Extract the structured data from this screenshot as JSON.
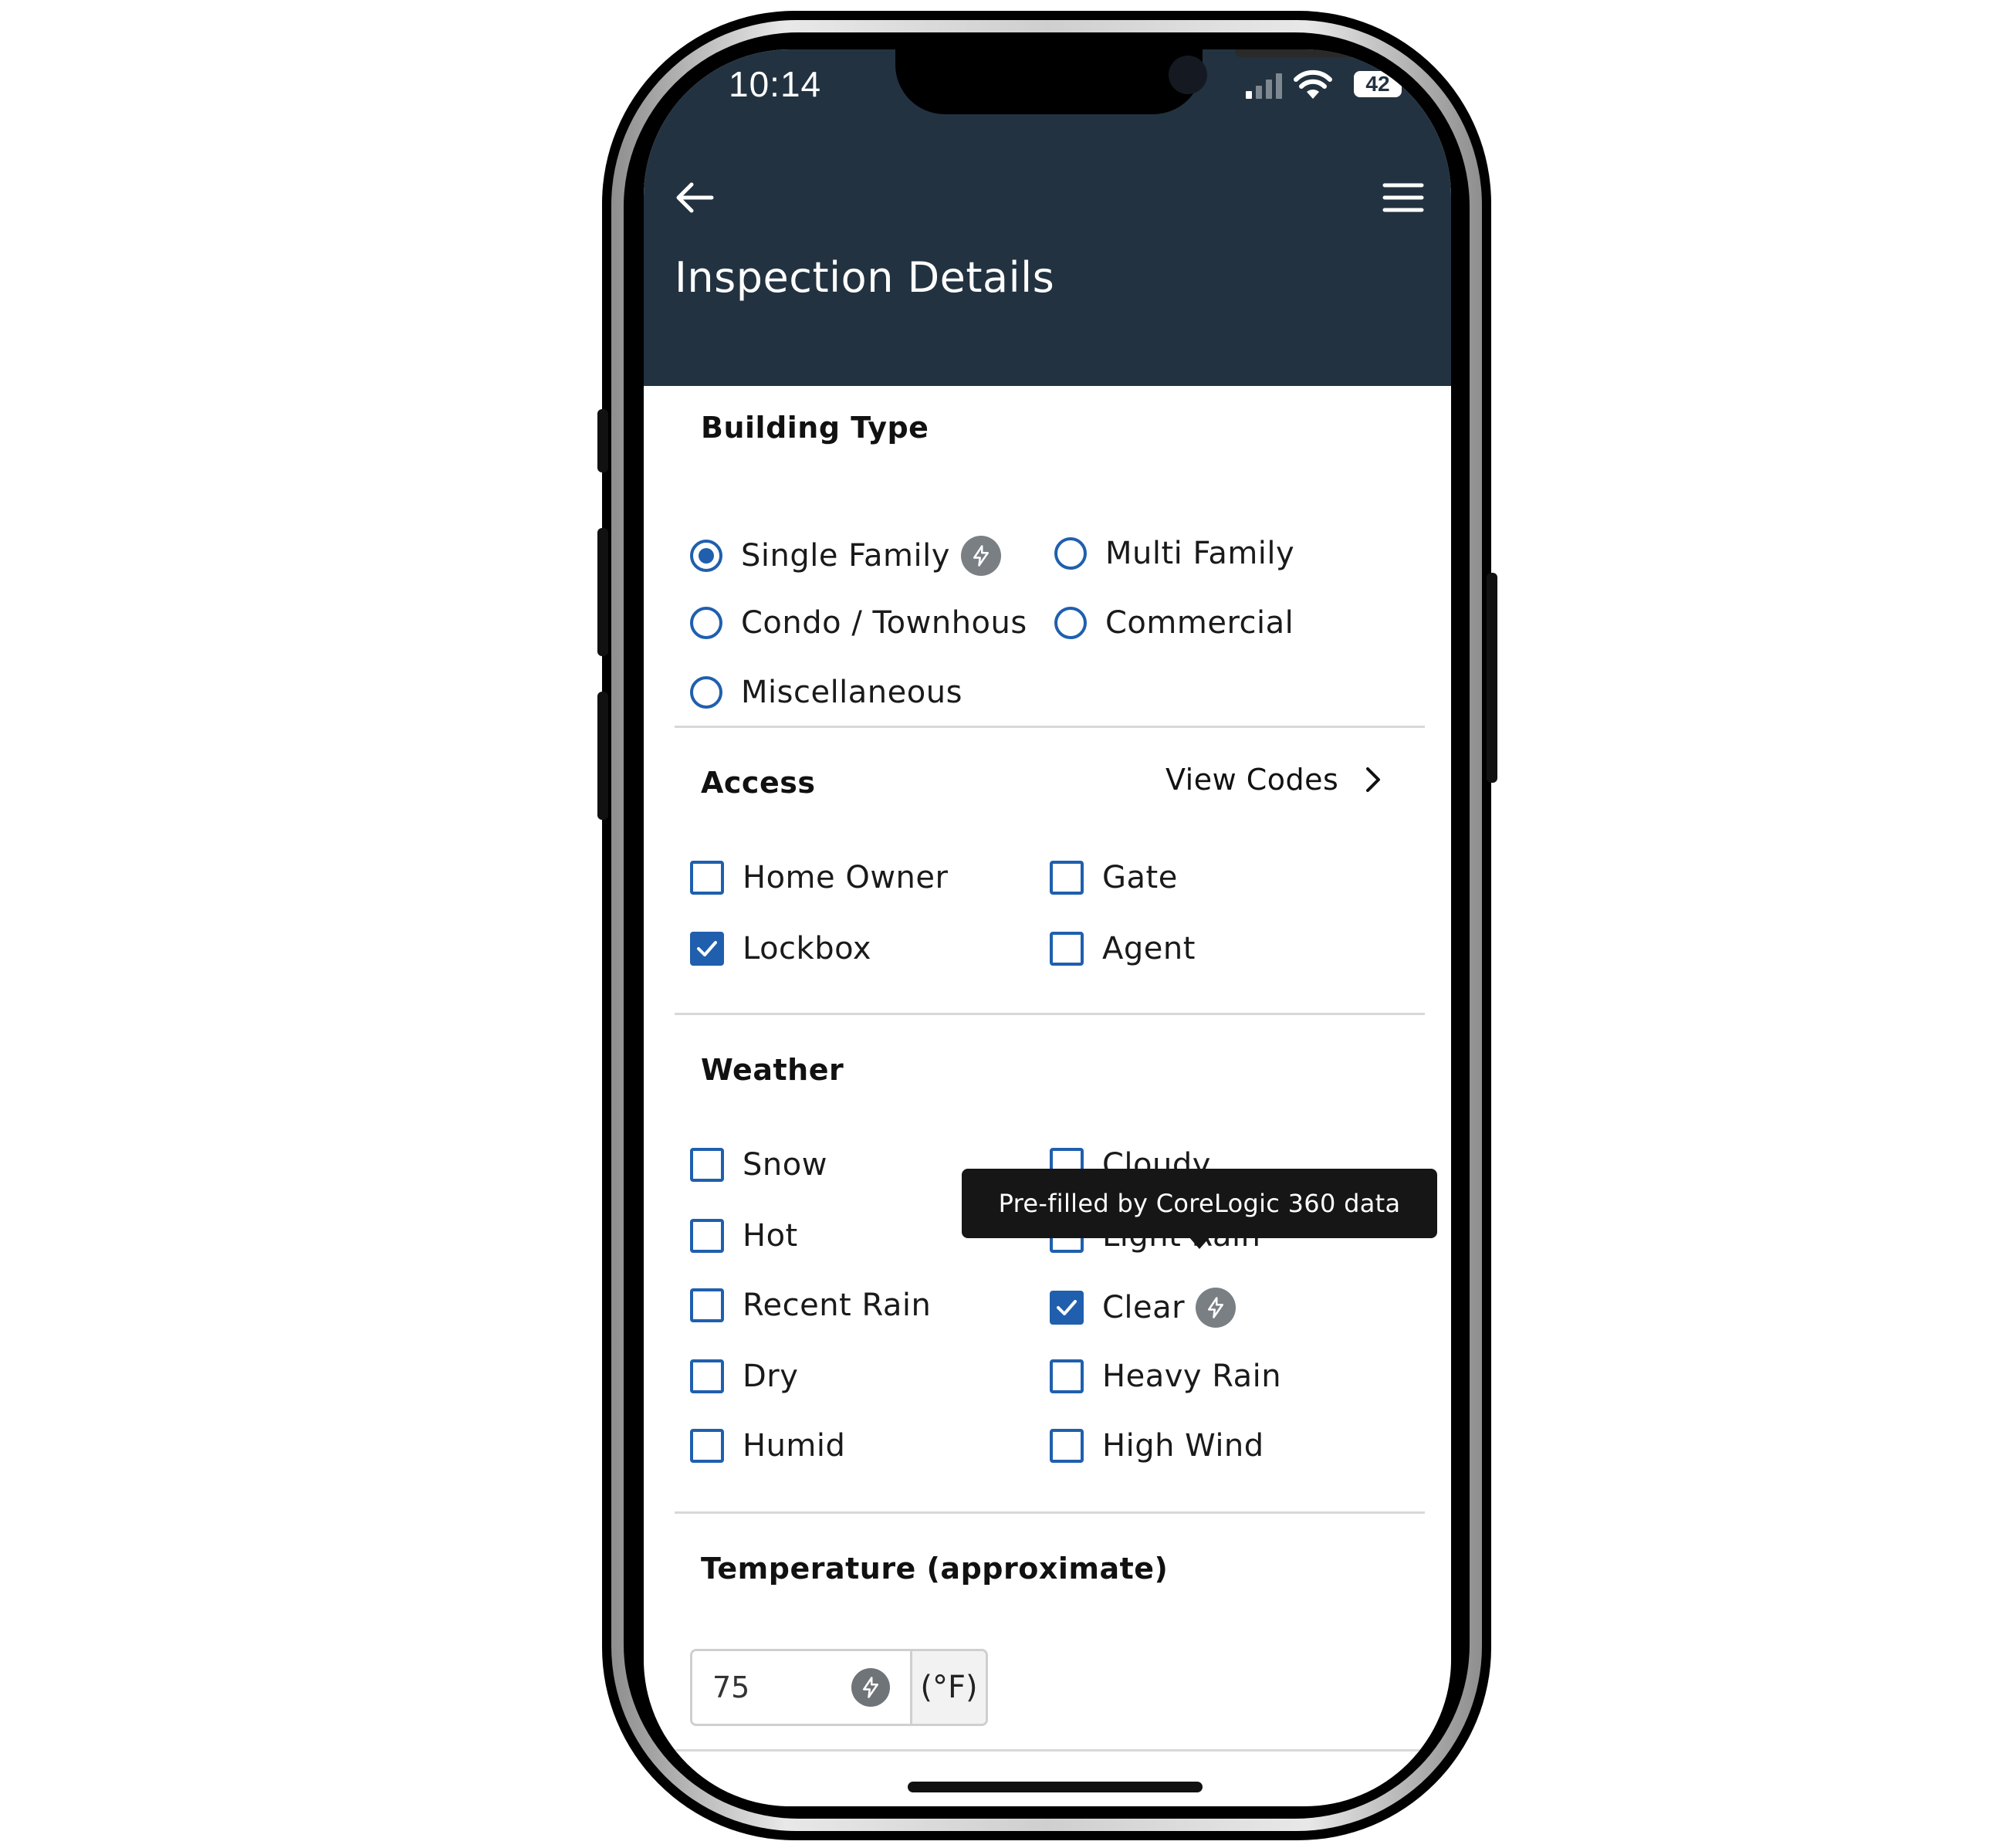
{
  "status_bar": {
    "time": "10:14",
    "battery": "42"
  },
  "header": {
    "title": "Inspection Details"
  },
  "building_type": {
    "title": "Building Type",
    "options": [
      {
        "label": "Single Family",
        "selected": true,
        "prefilled": true
      },
      {
        "label": "Multi Family",
        "selected": false
      },
      {
        "label": "Condo / Townhouse",
        "selected": false
      },
      {
        "label": "Commercial",
        "selected": false
      },
      {
        "label": "Miscellaneous",
        "selected": false
      }
    ]
  },
  "access": {
    "title": "Access",
    "view_codes": "View Codes",
    "options": [
      {
        "label": "Home Owner",
        "checked": false
      },
      {
        "label": "Gate",
        "checked": false
      },
      {
        "label": "Lockbox",
        "checked": true
      },
      {
        "label": "Agent",
        "checked": false
      }
    ]
  },
  "weather": {
    "title": "Weather",
    "options": [
      {
        "label": "Snow",
        "checked": false
      },
      {
        "label": "Cloudy",
        "checked": false
      },
      {
        "label": "Hot",
        "checked": false
      },
      {
        "label": "Light Rain",
        "checked": false
      },
      {
        "label": "Recent Rain",
        "checked": false
      },
      {
        "label": "Clear",
        "checked": true,
        "prefilled": true
      },
      {
        "label": "Dry",
        "checked": false
      },
      {
        "label": "Heavy Rain",
        "checked": false
      },
      {
        "label": "Humid",
        "checked": false
      },
      {
        "label": "High Wind",
        "checked": false
      }
    ]
  },
  "tooltip": {
    "text": "Pre-filled by CoreLogic 360 data"
  },
  "temperature": {
    "title": "Temperature (approximate)",
    "value": "75",
    "unit": "(°F)"
  },
  "colors": {
    "header_bg": "#223240",
    "accent": "#1f5fae",
    "prefill_badge": "#7a7f84"
  },
  "icons": [
    "back-arrow-icon",
    "hamburger-menu-icon",
    "chevron-right-icon",
    "lightning-bolt-icon",
    "checkmark-icon"
  ]
}
